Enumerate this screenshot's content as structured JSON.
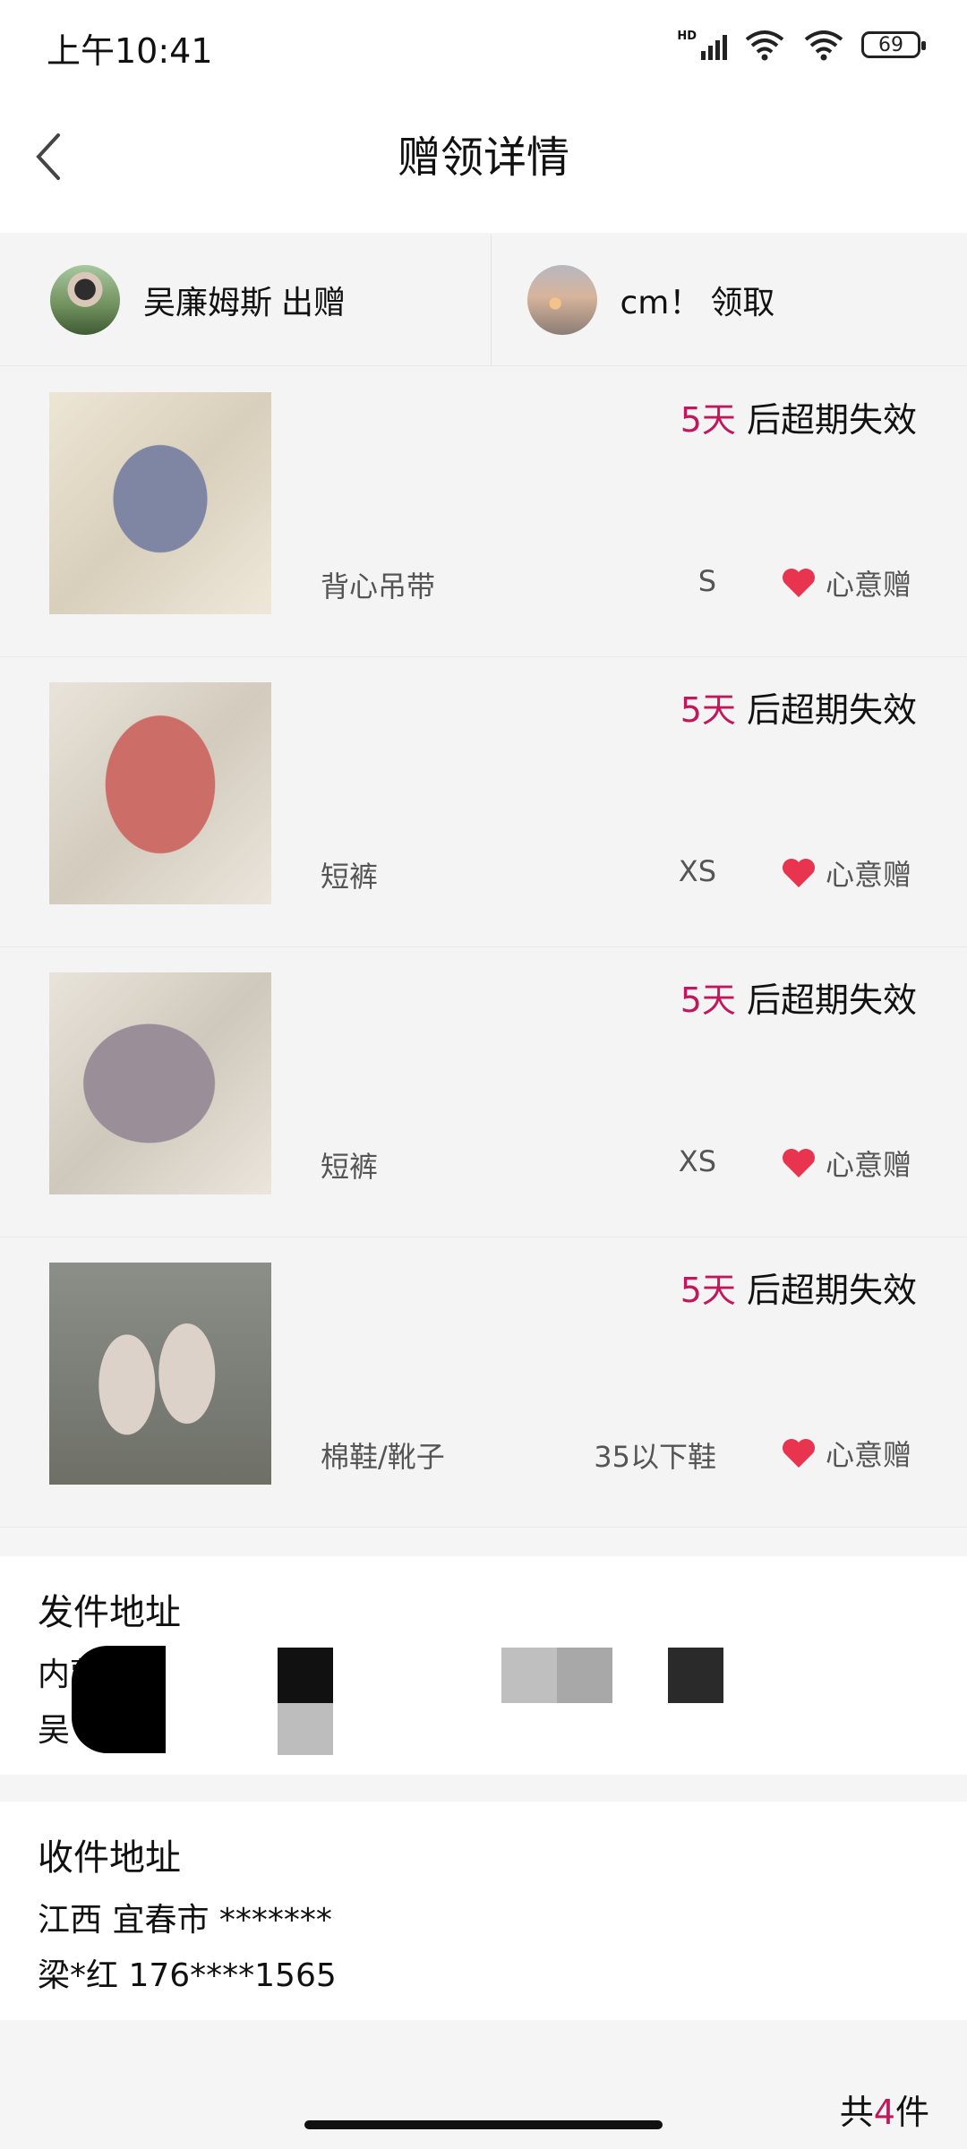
{
  "status_bar": {
    "time": "上午10:41",
    "network": "HD",
    "battery": "69"
  },
  "nav": {
    "title": "赠领详情",
    "back_icon": "chevron-left-icon"
  },
  "giver": {
    "name": "吴廉姆斯",
    "action": "出赠"
  },
  "receiver": {
    "name": "cm！",
    "action": "领取"
  },
  "items": [
    {
      "days": "5天",
      "expire_text": "后超期失效",
      "name": "背心吊带",
      "size": "S",
      "tag": "心意赠"
    },
    {
      "days": "5天",
      "expire_text": "后超期失效",
      "name": "短裤",
      "size": "XS",
      "tag": "心意赠"
    },
    {
      "days": "5天",
      "expire_text": "后超期失效",
      "name": "短裤",
      "size": "XS",
      "tag": "心意赠"
    },
    {
      "days": "5天",
      "expire_text": "后超期失效",
      "name": "棉鞋/靴子",
      "size": "35以下鞋",
      "tag": "心意赠"
    }
  ],
  "send_address": {
    "heading": "发件地址",
    "line1": "内蒙古",
    "line2": "吴"
  },
  "recv_address": {
    "heading": "收件地址",
    "line1": "江西 宜春市 *******",
    "line2": "梁*红 176****1565"
  },
  "footer": {
    "prefix": "共",
    "count": "4",
    "suffix": "件"
  },
  "colors": {
    "accent": "#c2185b",
    "heart": "#e8344e"
  }
}
